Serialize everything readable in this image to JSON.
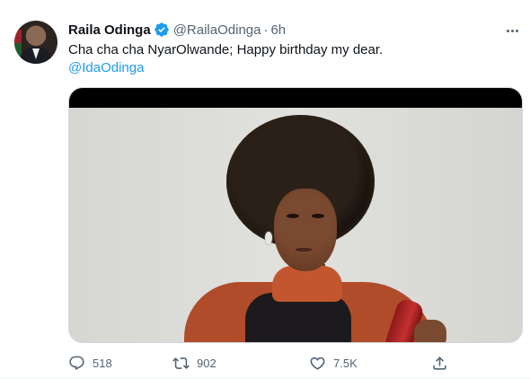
{
  "tweet": {
    "author": {
      "name": "Raila Odinga",
      "handle": "@RailaOdinga",
      "separator": "·",
      "time": "6h",
      "verified": true
    },
    "text": "Cha cha cha NyarOlwande; Happy birthday my dear.",
    "mention": "@IdaOdinga",
    "actions": {
      "replies": "518",
      "retweets": "902",
      "likes": "7.5K"
    }
  },
  "icons": {
    "verified": "verified-badge-icon",
    "more": "more-options-icon",
    "reply": "reply-icon",
    "retweet": "retweet-icon",
    "like": "heart-icon",
    "share": "share-icon"
  },
  "colors": {
    "accent": "#1d9bf0",
    "text_primary": "#0f1419",
    "text_secondary": "#536471"
  }
}
